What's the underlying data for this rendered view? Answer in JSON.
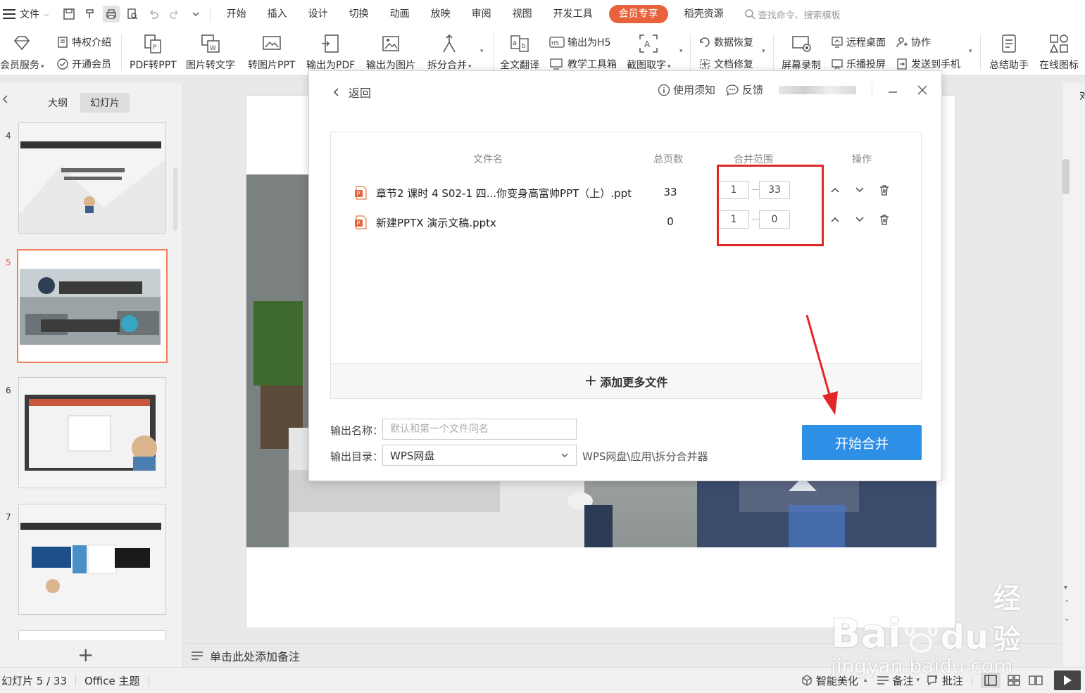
{
  "menubar": {
    "file_label": "文件",
    "tabs": [
      "开始",
      "插入",
      "设计",
      "切换",
      "动画",
      "放映",
      "审阅",
      "视图",
      "开发工具"
    ],
    "vip_tab": "会员专享",
    "resource_tab": "稻壳资源",
    "search_placeholder": "查找命令、搜索模板"
  },
  "ribbon": {
    "member_service": "会员服务",
    "privilege_intro": "特权介绍",
    "open_member": "开通会员",
    "pdf_to_ppt": "PDF转PPT",
    "image_to_text": "图片转文字",
    "to_image_ppt": "转图片PPT",
    "export_pdf": "输出为PDF",
    "export_image": "输出为图片",
    "split_merge": "拆分合并",
    "full_translate": "全文翻译",
    "export_h5": "输出为H5",
    "teaching_tools": "教学工具箱",
    "screenshot_ocr": "截图取字",
    "data_recovery": "数据恢复",
    "doc_repair": "文档修复",
    "screen_record": "屏幕录制",
    "remote_desktop": "远程桌面",
    "lebo_cast": "乐播投屏",
    "collaborate": "协作",
    "send_to_phone": "发送到手机",
    "summary_assistant": "总结助手",
    "online_icons": "在线图标"
  },
  "leftpanel": {
    "tab_outline": "大纲",
    "tab_slides": "幻灯片",
    "slides": [
      {
        "num": "4"
      },
      {
        "num": "5"
      },
      {
        "num": "6"
      },
      {
        "num": "7"
      }
    ]
  },
  "notes": {
    "placeholder": "单击此处添加备注"
  },
  "statusbar": {
    "slide_indicator": "幻灯片 5 / 33",
    "theme": "Office 主题",
    "smart_beautify": "智能美化",
    "notes": "备注",
    "comments": "批注"
  },
  "dialog": {
    "back": "返回",
    "usage_notes": "使用须知",
    "feedback": "反馈",
    "headers": {
      "filename": "文件名",
      "total_pages": "总页数",
      "merge_range": "合并范围",
      "actions": "操作"
    },
    "files": [
      {
        "name": "章节2 课时 4 S02-1 四...你变身高富帅PPT（上）.ppt",
        "pages": "33",
        "from": "1",
        "to": "33"
      },
      {
        "name": "新建PPTX 演示文稿.pptx",
        "pages": "0",
        "from": "1",
        "to": "0"
      }
    ],
    "add_more": "添加更多文件",
    "output_name_label": "输出名称：",
    "output_name_placeholder": "默认和第一个文件同名",
    "output_dir_label": "输出目录：",
    "output_dir_value": "WPS网盘",
    "output_dir_path": "WPS网盘\\应用\\拆分合并器",
    "start_merge": "开始合并"
  },
  "watermark": {
    "brand": "Bai",
    "brand2": "du",
    "cn": "经验",
    "url": "jingyan.baidu.com"
  },
  "colors": {
    "accent": "#2d8fe5",
    "vip": "#e8623b",
    "highlight": "#e32727"
  }
}
